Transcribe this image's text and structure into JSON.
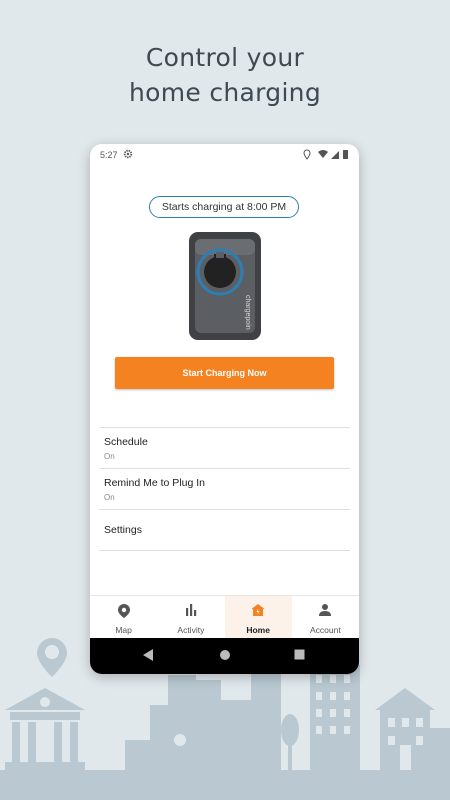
{
  "headline": {
    "line1": "Control your",
    "line2": "home charging"
  },
  "status_bar": {
    "time": "5:27"
  },
  "schedule_pill": "Starts charging at 8:00 PM",
  "charger_brand": "chargepoin",
  "start_button": "Start Charging Now",
  "menu": [
    {
      "title": "Schedule",
      "value": "On"
    },
    {
      "title": "Remind Me to Plug In",
      "value": "On"
    },
    {
      "title": "Settings"
    }
  ],
  "bottom_nav": [
    {
      "label": "Map",
      "icon": "map-pin-icon"
    },
    {
      "label": "Activity",
      "icon": "bar-chart-icon"
    },
    {
      "label": "Home",
      "icon": "home-icon",
      "active": true
    },
    {
      "label": "Account",
      "icon": "person-icon"
    }
  ],
  "colors": {
    "accent": "#f58220",
    "pill_border": "#2f7eb3",
    "background": "#e1e8ec",
    "skyline": "#b8c7d0"
  }
}
